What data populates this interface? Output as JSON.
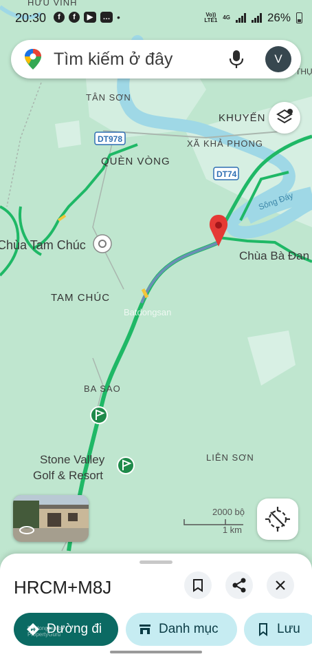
{
  "status_bar": {
    "time": "20:30",
    "network_line1": "Vo))",
    "network_line2": "LTE1",
    "network_4g": "4G",
    "battery": "26%"
  },
  "search": {
    "placeholder": "Tìm kiếm ở đây",
    "avatar_initial": "V"
  },
  "map": {
    "labels": {
      "huu_vinh": "HỮU VINH",
      "tan_son": "TÂN SƠN",
      "khuyen": "KHUYẾN",
      "dt978": "DT978",
      "xa_kha_phong": "XÃ KHẢ PHONG",
      "quen_vong": "QUÈN VÒNG",
      "dt74": "DT74",
      "song_day": "Sông Đáy",
      "chua_tam_chuc": "Chùa Tam Chúc",
      "chua_ba_danh": "Chùa Bà Đan",
      "tam_chuc": "TAM CHÚC",
      "ba_sao": "BA SAO",
      "stone_valley_1": "Stone Valley",
      "stone_valley_2": "Golf & Resort",
      "lien_son": "LIÊN SƠN",
      "thu": "THỤ",
      "watermark": "Batdongsan"
    },
    "scale_imperial": "2000 bộ",
    "scale_metric": "1 km"
  },
  "place_sheet": {
    "plus_code": "HRCM+M8J",
    "directions_label": "Đường đi",
    "category_label": "Danh mục",
    "save_label": "Lưu",
    "watermark_small": "Batdongsan by PropertyGuru"
  },
  "colors": {
    "map_bg": "#bfe6cf",
    "water": "#9fd8e6",
    "traffic_green": "#1fb866",
    "route_blue": "#6b8fb5",
    "primary_chip": "#0b6a63",
    "secondary_chip": "#c6ecf2"
  }
}
